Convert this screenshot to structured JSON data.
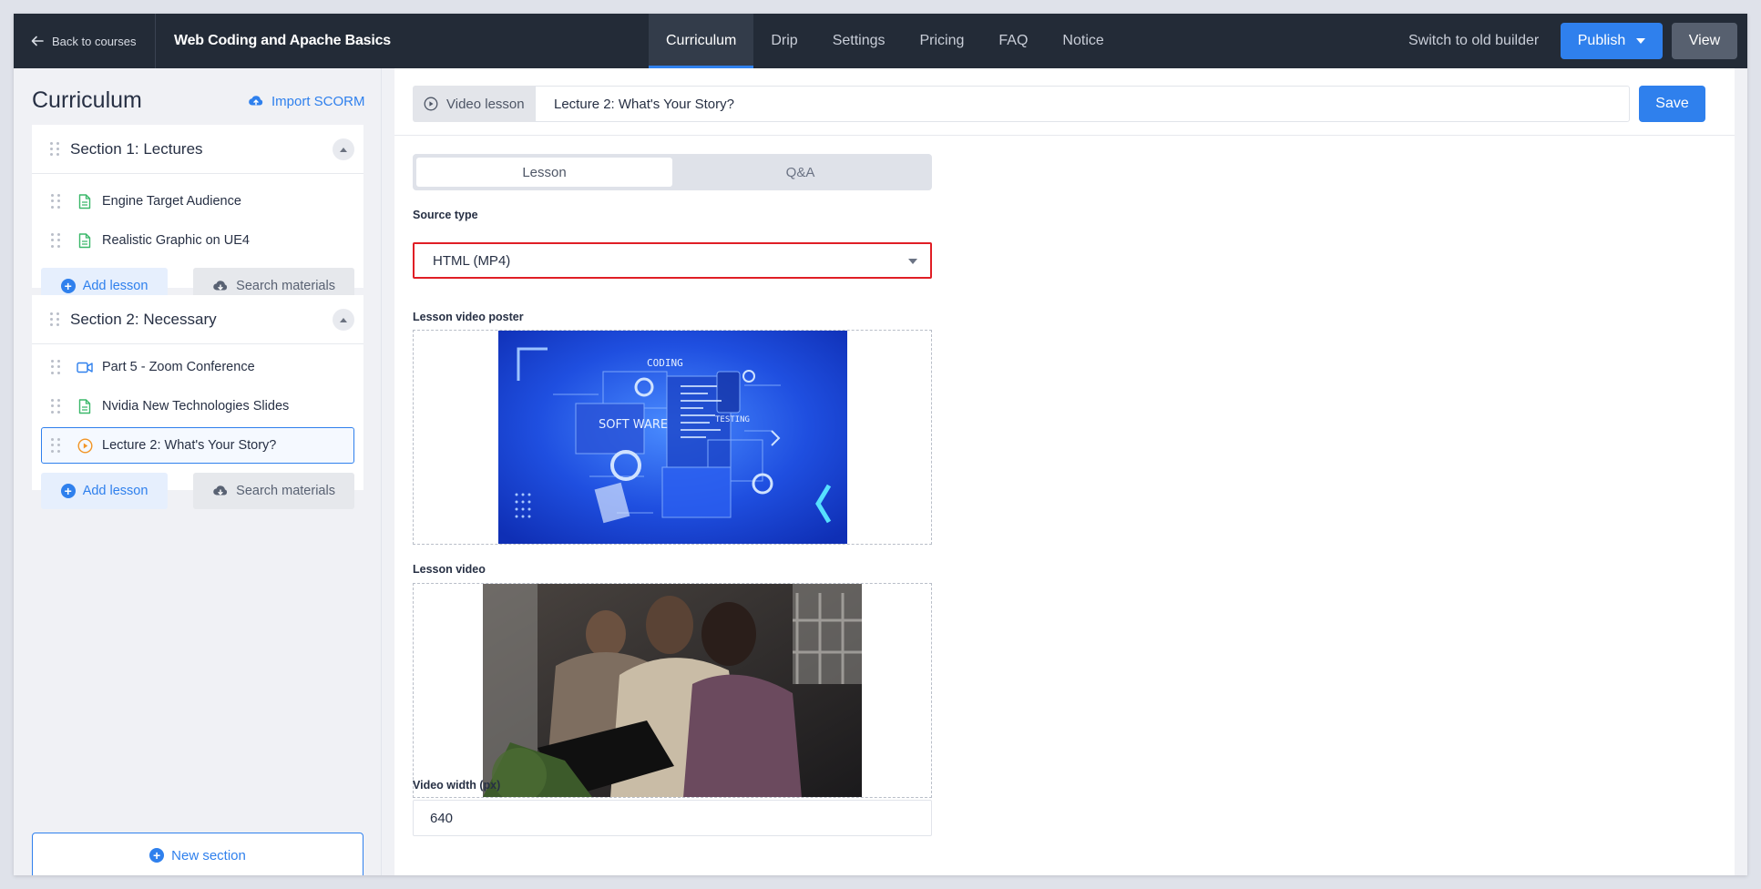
{
  "topbar": {
    "back_label": "Back to courses",
    "course_title": "Web Coding and Apache Basics",
    "tabs": [
      {
        "label": "Curriculum",
        "active": true
      },
      {
        "label": "Drip",
        "active": false
      },
      {
        "label": "Settings",
        "active": false
      },
      {
        "label": "Pricing",
        "active": false
      },
      {
        "label": "FAQ",
        "active": false
      },
      {
        "label": "Notice",
        "active": false
      }
    ],
    "old_builder_label": "Switch to old builder",
    "publish_label": "Publish",
    "view_label": "View"
  },
  "sidebar": {
    "title": "Curriculum",
    "import_label": "Import SCORM",
    "sections": [
      {
        "title": "Section 1: Lectures",
        "lessons": [
          {
            "label": "Engine Target Audience",
            "icon": "text-document-icon"
          },
          {
            "label": "Realistic Graphic on UE4",
            "icon": "text-document-icon"
          }
        ],
        "add_lesson_label": "Add lesson",
        "search_materials_label": "Search materials"
      },
      {
        "title": "Section 2: Necessary",
        "lessons": [
          {
            "label": "Part 5 - Zoom Conference",
            "icon": "video-camera-icon"
          },
          {
            "label": "Nvidia New Technologies Slides",
            "icon": "text-document-icon"
          },
          {
            "label": "Lecture 2: What's Your Story?",
            "icon": "play-circle-icon",
            "selected": true
          }
        ],
        "add_lesson_label": "Add lesson",
        "search_materials_label": "Search materials"
      }
    ],
    "new_section_label": "New section"
  },
  "editor": {
    "lesson_type_label": "Video lesson",
    "lesson_name": "Lecture 2: What's Your Story?",
    "save_label": "Save",
    "tabs": {
      "lesson": "Lesson",
      "qa": "Q&A"
    },
    "source_type_label": "Source type",
    "source_type_value": "HTML (MP4)",
    "poster_label": "Lesson video poster",
    "poster_texts": {
      "coding": "CODING",
      "software": "SOFT WARE",
      "testing": "TESTING"
    },
    "video_label": "Lesson video",
    "video_width_label": "Video width (px)",
    "video_width_value": "640"
  },
  "colors": {
    "accent": "#2f80ed",
    "topbar": "#232b37",
    "highlight_border": "#e01e25",
    "doc_icon": "#3bb86a",
    "video_icon": "#2f80ed",
    "play_icon": "#f29525"
  }
}
